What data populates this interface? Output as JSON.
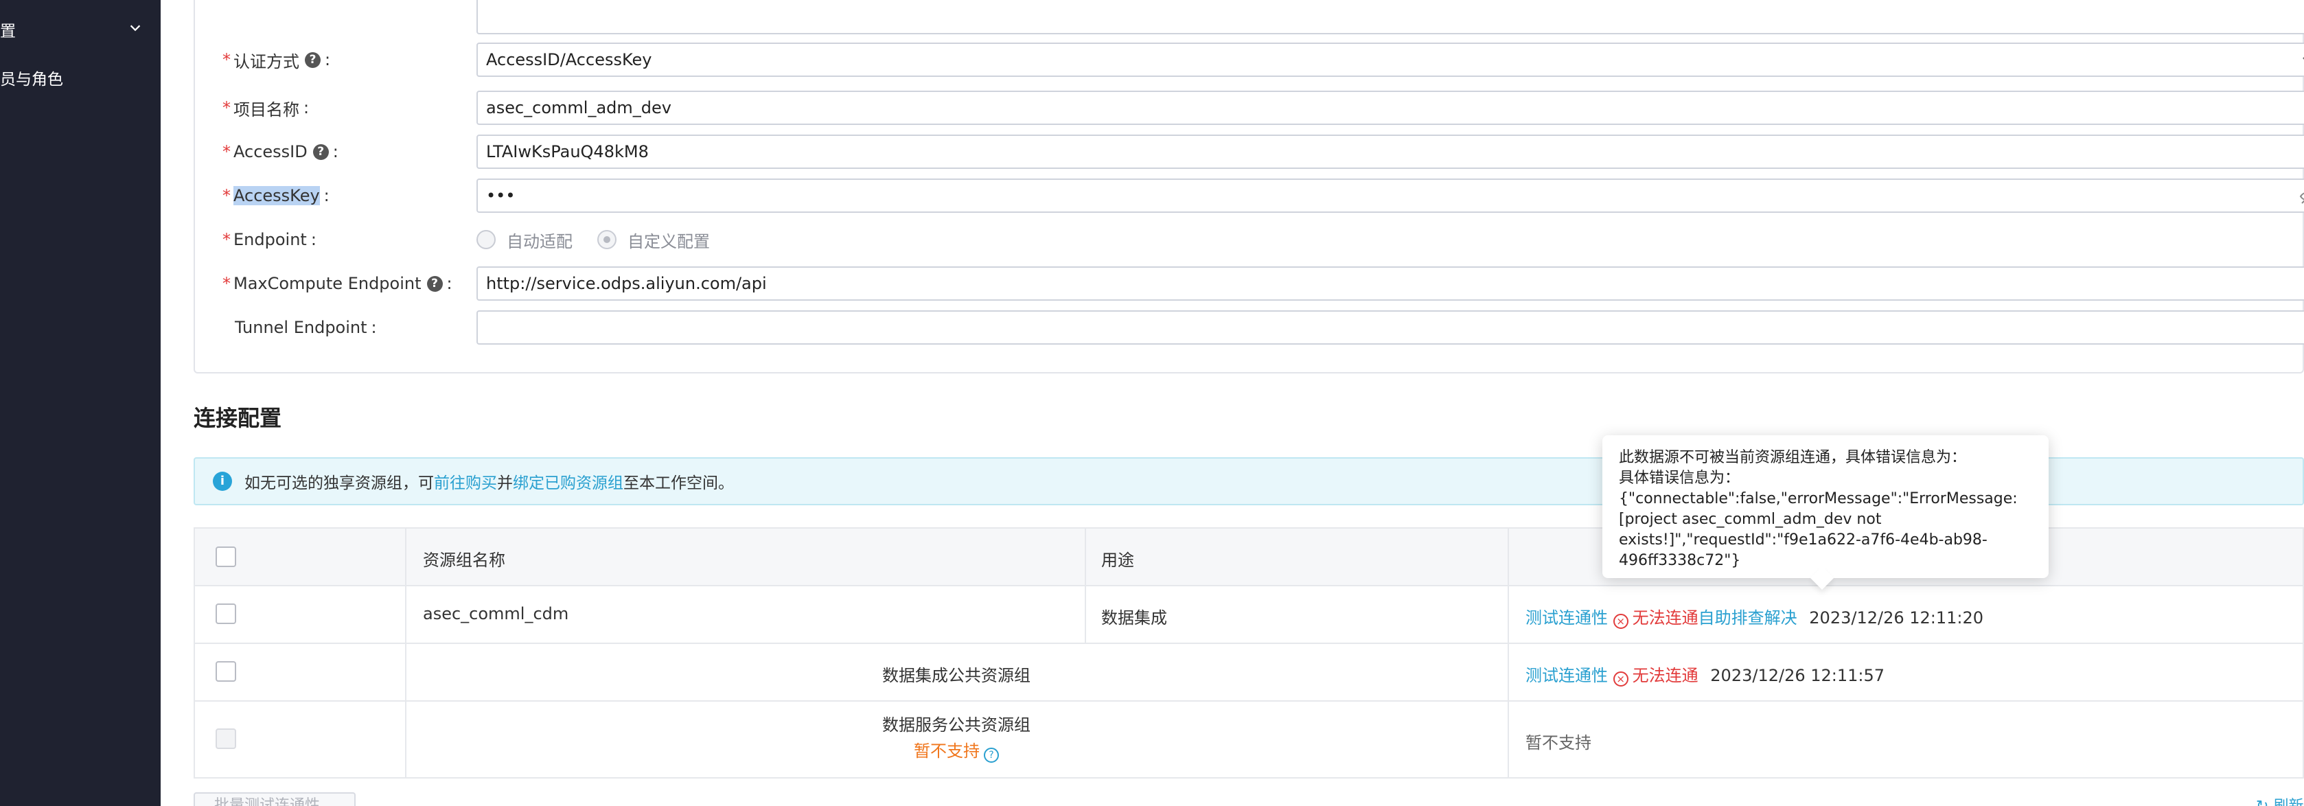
{
  "sidebar": {
    "item1": "置",
    "item2": "员与角色"
  },
  "form": {
    "auth_label": "认证方式",
    "auth_value": "AccessID/AccessKey",
    "project_label": "项目名称",
    "project_value": "asec_comml_adm_dev",
    "accessid_label": "AccessID",
    "accessid_value": "LTAIwKsPauQ48kM8",
    "accesskey_label": "AccessKey",
    "accesskey_value": "•••",
    "endpoint_label": "Endpoint",
    "endpoint_opt1": "自动适配",
    "endpoint_opt2": "自定义配置",
    "mc_endpoint_label": "MaxCompute Endpoint",
    "mc_endpoint_value": "http://service.odps.aliyun.com/api",
    "tunnel_label": "Tunnel Endpoint",
    "tunnel_value": "",
    "colon": ":",
    "required_mark": "*",
    "help_glyph": "?"
  },
  "connection": {
    "title": "连接配置",
    "alert": {
      "prefix": "如无可选的独享资源组，可",
      "link1": "前往购买",
      "mid": "并",
      "link2": "绑定已购资源组",
      "suffix": "至本工作空间。"
    },
    "table": {
      "headers": {
        "name": "资源组名称",
        "usage": "用途"
      },
      "rows": [
        {
          "name": "asec_comml_cdm",
          "usage": "数据集成",
          "test_link": "测试连通性",
          "status": "无法连通",
          "self_help": "自助排查解决",
          "time": "2023/12/26 12:11:20"
        },
        {
          "name": "数据集成公共资源组",
          "test_link": "测试连通性",
          "status": "无法连通",
          "time": "2023/12/26 12:11:57"
        },
        {
          "name": "数据服务公共资源组",
          "name_note": "暂不支持",
          "status_text": "暂不支持"
        }
      ]
    },
    "tooltip": {
      "line1": "此数据源不可被当前资源组连通，具体错误信息为：",
      "line2": "具体错误信息为：",
      "line3": "{\"connectable\":false,\"errorMessage\":\"ErrorMessage:",
      "line4": "[project asec_comml_adm_dev not",
      "line5": "exists!]\",\"requestId\":\"f9e1a622-a7f6-4e4b-ab98-",
      "line6": "496ff3338c72\"}"
    },
    "batch_button": "批量测试连通性",
    "refresh_link": "刷新"
  }
}
